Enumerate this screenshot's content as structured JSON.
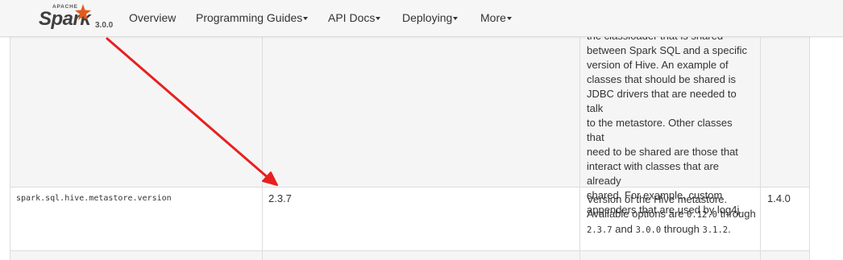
{
  "brand": {
    "apache": "APACHE",
    "name": "Spark",
    "version": "3.0.0"
  },
  "nav": {
    "items": [
      {
        "label": "Overview",
        "dropdown": false
      },
      {
        "label": "Programming Guides",
        "dropdown": true
      },
      {
        "label": "API Docs",
        "dropdown": true
      },
      {
        "label": "Deploying",
        "dropdown": true
      },
      {
        "label": "More",
        "dropdown": true
      }
    ]
  },
  "table": {
    "prev_row_description": [
      "the classloader that is shared",
      "between Spark SQL and a specific",
      "version of Hive. An example of",
      "classes that should be shared is",
      "JDBC drivers that are needed to talk",
      "to the metastore. Other classes that",
      "need to be shared are those that",
      "interact with classes that are already",
      "shared. For example, custom",
      "appenders that are used by log4j."
    ],
    "row": {
      "property": "spark.sql.hive.metastore.version",
      "default": "2.3.7",
      "description_line1": "Version of the Hive metastore.",
      "description_line2_text": "Available options are",
      "opt_a": "0.12.0",
      "through1": "through",
      "opt_b": "2.3.7",
      "and": "and",
      "opt_c": "3.0.0",
      "through2": "through",
      "opt_d": "3.1.2",
      "period": ".",
      "since": "1.4.0"
    }
  },
  "colors": {
    "arrow": "#e8201f",
    "row_alt": "#f5f5f5",
    "border": "#dddddd",
    "navbar": "#f6f6f6"
  }
}
